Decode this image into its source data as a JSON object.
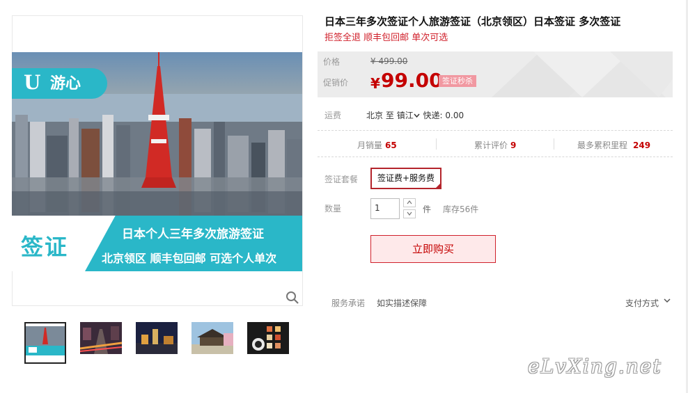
{
  "product": {
    "title": "日本三年多次签证个人旅游签证（北京领区）日本签证 多次签证",
    "subtitle": "拒签全退 顺丰包回邮 单次可选"
  },
  "main_image": {
    "logo_text": "游心",
    "visa_big": "签证",
    "visa_line1": "日本个人三年多次旅游签证",
    "visa_line2": "北京领区  顺丰包回邮  可选个人单次"
  },
  "price": {
    "original_label": "价格",
    "original_value": "¥ 499.00",
    "promo_label": "促销价",
    "currency": "¥",
    "promo_value": "99.00",
    "promo_tag": "签证秒杀"
  },
  "shipping": {
    "label": "运费",
    "from": "北京",
    "to_word": "至",
    "destination": "镇江",
    "express": "快递: 0.00"
  },
  "stats": [
    {
      "label": "月销量",
      "value": "65"
    },
    {
      "label": "累计评价",
      "value": "9"
    },
    {
      "label": "最多累积里程",
      "value": "249"
    }
  ],
  "package": {
    "label": "签证套餐",
    "option": "签证费+服务费"
  },
  "quantity": {
    "label": "数量",
    "value": "1",
    "unit": "件",
    "stock": "库存56件"
  },
  "buy_button": "立即购买",
  "service": {
    "label": "服务承诺",
    "text": "如实描述保障",
    "payment": "支付方式"
  },
  "watermark": "eLvXing.net",
  "colors": {
    "accent_red": "#c40000",
    "teal": "#2ab7c8",
    "promo_tag": "#f198a1"
  }
}
